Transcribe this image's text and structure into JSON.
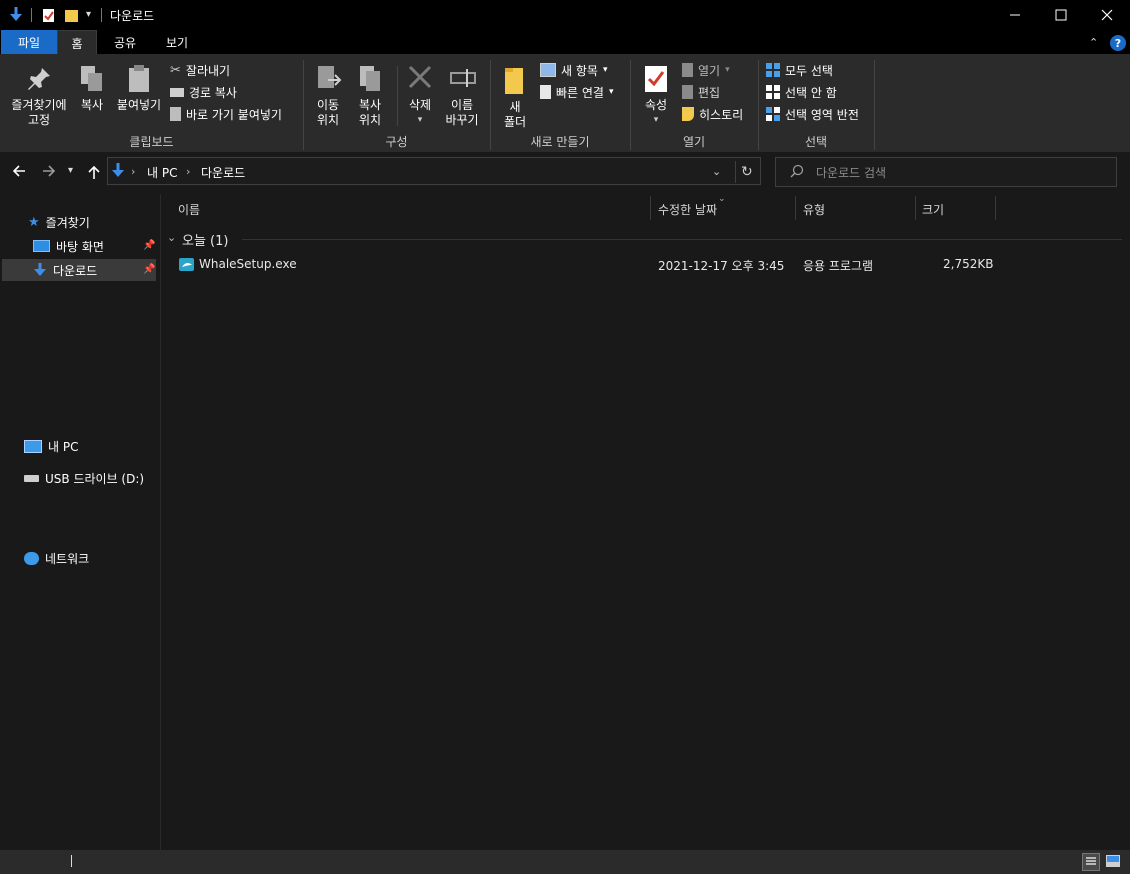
{
  "window": {
    "title": "다운로드",
    "minimize_icon": "minimize-icon",
    "maximize_icon": "maximize-icon",
    "close_icon": "close-icon"
  },
  "tabs": [
    {
      "label": "파일"
    },
    {
      "label": "홈"
    },
    {
      "label": "공유"
    },
    {
      "label": "보기"
    }
  ],
  "ribbon": {
    "clipboard": {
      "pin_label_1": "즐겨찾기에",
      "pin_label_2": "고정",
      "copy_label": "복사",
      "paste_label": "붙여넣기",
      "cut_label": "잘라내기",
      "copy_path_label": "경로 복사",
      "paste_shortcut_label": "바로 가기 붙여넣기",
      "group_label": "클립보드"
    },
    "organize": {
      "move_label_1": "이동",
      "move_label_2": "위치",
      "copyto_label_1": "복사",
      "copyto_label_2": "위치",
      "delete_label": "삭제",
      "rename_label_1": "이름",
      "rename_label_2": "바꾸기",
      "group_label": "구성"
    },
    "new": {
      "new_folder_label_1": "새",
      "new_folder_label_2": "폴더",
      "new_item_label": "새 항목",
      "easy_access_label": "빠른 연결",
      "group_label": "새로 만들기"
    },
    "open": {
      "properties_label": "속성",
      "open_label": "열기",
      "edit_label": "편집",
      "history_label": "히스토리",
      "group_label": "열기"
    },
    "select": {
      "select_all_label": "모두 선택",
      "select_none_label": "선택 안 함",
      "invert_label": "선택 영역 반전",
      "group_label": "선택"
    }
  },
  "address": {
    "crumbs": [
      "내 PC",
      "다운로드"
    ],
    "search_placeholder": "다운로드 검색"
  },
  "nav": {
    "quick_access": "즐겨찾기",
    "desktop": "바탕 화면",
    "downloads": "다운로드",
    "this_pc": "내 PC",
    "usb": "USB 드라이브 (D:)",
    "network": "네트워크"
  },
  "columns": [
    "이름",
    "수정한 날짜",
    "유형",
    "크기"
  ],
  "group": {
    "label": "오늘 (1)"
  },
  "files": [
    {
      "name": "WhaleSetup.exe",
      "modified": "2021-12-17 오후 3:45",
      "type": "응용 프로그램",
      "size": "2,752KB"
    }
  ],
  "colors": {
    "accent": "#1a6ac7",
    "background": "#191919",
    "ribbon": "#2b2b2b"
  }
}
